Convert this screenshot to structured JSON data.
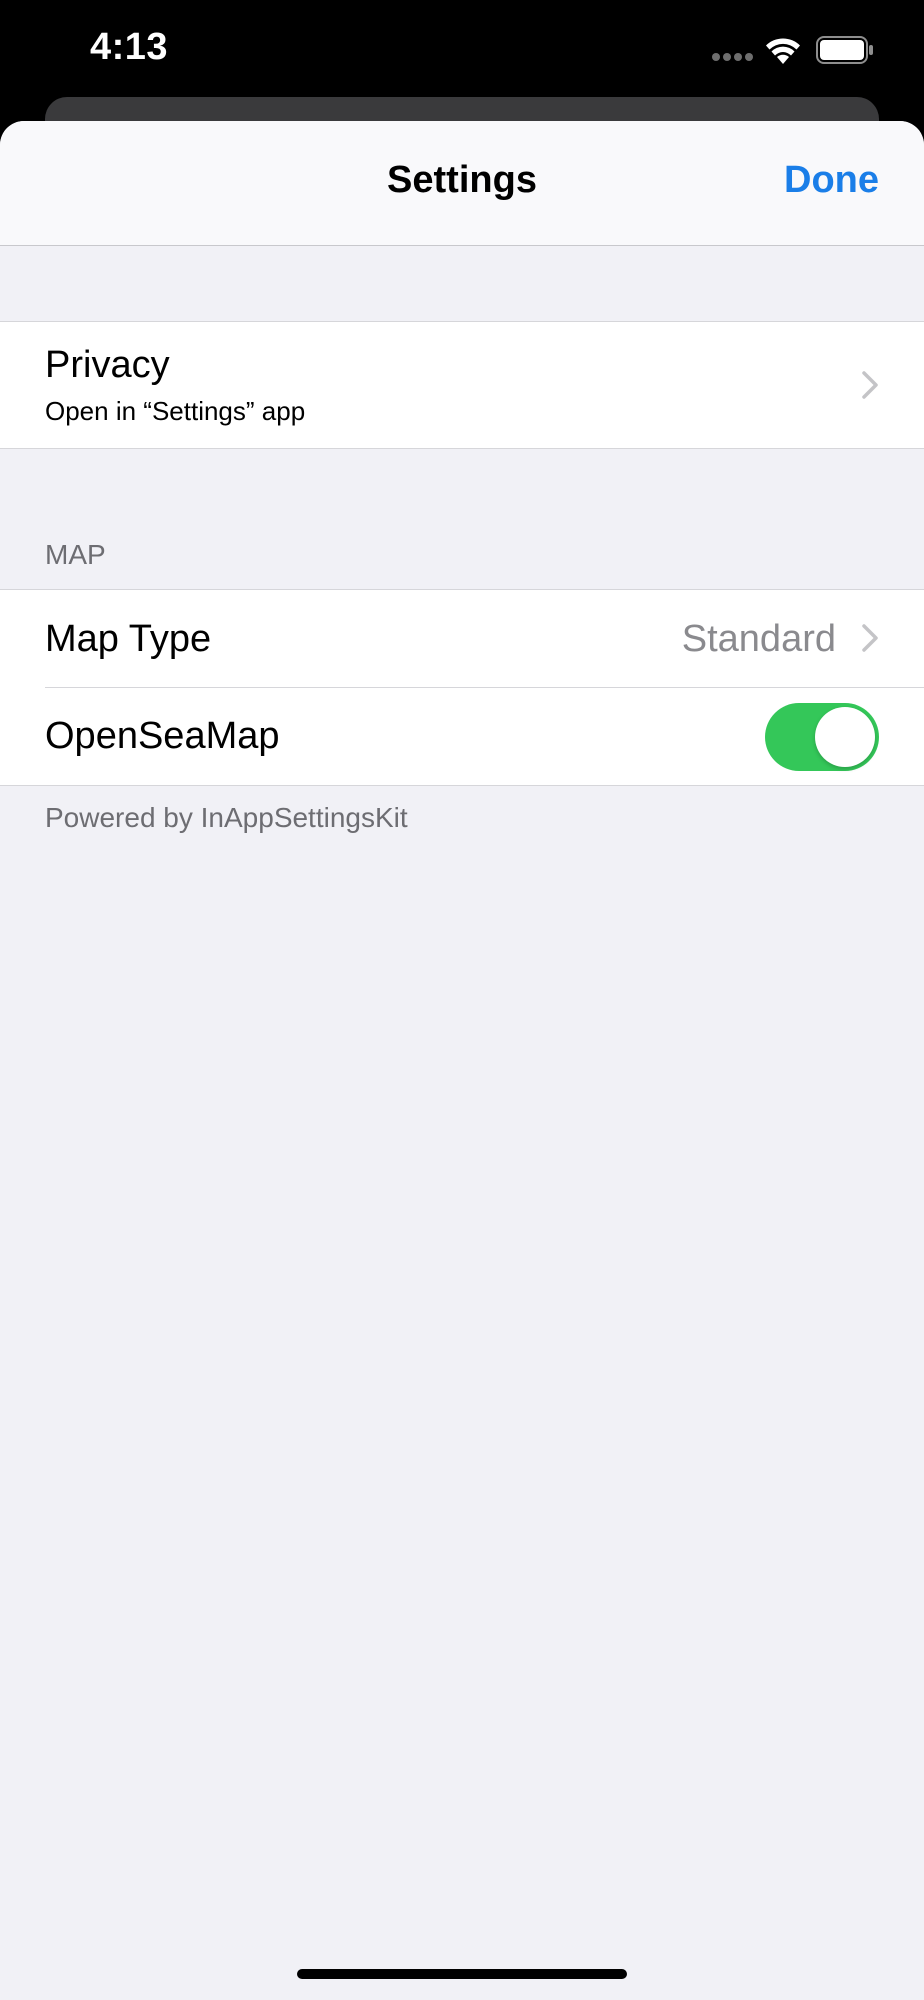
{
  "status_bar": {
    "time": "4:13"
  },
  "nav": {
    "title": "Settings",
    "done_label": "Done"
  },
  "privacy": {
    "title": "Privacy",
    "subtitle": "Open in “Settings” app"
  },
  "map_section": {
    "header": "MAP",
    "map_type": {
      "label": "Map Type",
      "value": "Standard"
    },
    "opensea": {
      "label": "OpenSeaMap",
      "enabled": true
    },
    "footer": "Powered by InAppSettingsKit"
  },
  "colors": {
    "accent": "#1a7ee8",
    "toggle_on": "#34c759",
    "background": "#f1f1f6"
  }
}
